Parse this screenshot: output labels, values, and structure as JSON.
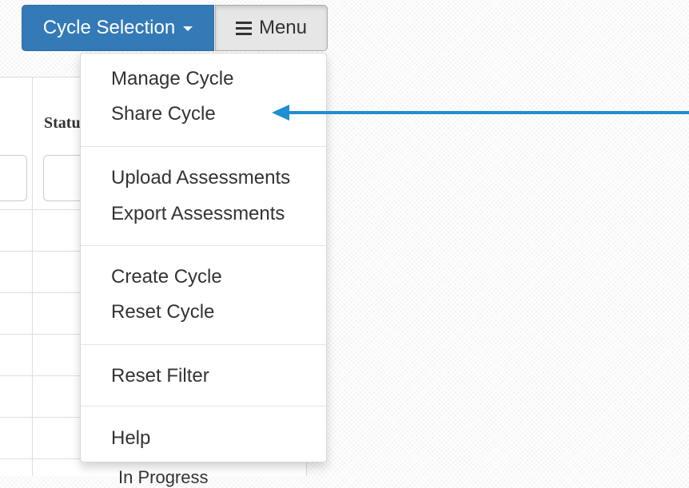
{
  "toolbar": {
    "cycle_selection_label": "Cycle Selection",
    "menu_label": "Menu"
  },
  "menu": {
    "items": [
      {
        "label": "Manage Cycle"
      },
      {
        "label": "Share Cycle"
      },
      {
        "label": "Upload Assessments"
      },
      {
        "label": "Export Assessments"
      },
      {
        "label": "Create Cycle"
      },
      {
        "label": "Reset Cycle"
      },
      {
        "label": "Reset Filter"
      },
      {
        "label": "Help"
      }
    ]
  },
  "table": {
    "status_header": "Status",
    "last_row_status": "In Progress"
  },
  "icons": {
    "menu_icon": "hamburger-icon",
    "caret_icon": "caret-down-icon",
    "annotation": "arrow-left-icon"
  },
  "colors": {
    "primary": "#337ab7",
    "annotation_arrow": "#1f8fd1"
  }
}
